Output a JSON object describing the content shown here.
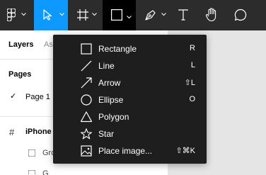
{
  "toolbar": {
    "tools": [
      {
        "name": "main-menu",
        "icon": "figma-logo-icon"
      },
      {
        "name": "move-tool",
        "icon": "cursor-arrow-icon",
        "active": true
      },
      {
        "name": "frame-tool",
        "icon": "frame-hash-icon"
      },
      {
        "name": "shape-tool",
        "icon": "rectangle-icon",
        "active": true
      },
      {
        "name": "pen-tool",
        "icon": "pen-icon"
      },
      {
        "name": "text-tool",
        "icon": "text-icon"
      },
      {
        "name": "hand-tool",
        "icon": "hand-icon"
      },
      {
        "name": "comment-tool",
        "icon": "comment-icon"
      }
    ],
    "colors": {
      "background": "#2c2c2c",
      "active_blue": "#0d99ff",
      "active_black": "#000000"
    }
  },
  "panel": {
    "tabs": {
      "layers": "Layers",
      "assets": "As"
    },
    "pages_label": "Pages",
    "page": {
      "check": "✓",
      "name": "Page 1"
    },
    "frame": {
      "icon": "#",
      "name": "iPhone"
    },
    "layers": [
      "Gro",
      "G"
    ]
  },
  "menu": {
    "items": [
      {
        "label": "Rectangle",
        "shortcut": "R",
        "icon": "rectangle-icon"
      },
      {
        "label": "Line",
        "shortcut": "L",
        "icon": "line-icon"
      },
      {
        "label": "Arrow",
        "shortcut": "⇧L",
        "icon": "arrow-icon"
      },
      {
        "label": "Ellipse",
        "shortcut": "O",
        "icon": "ellipse-icon"
      },
      {
        "label": "Polygon",
        "shortcut": "",
        "icon": "polygon-icon"
      },
      {
        "label": "Star",
        "shortcut": "",
        "icon": "star-icon"
      },
      {
        "label": "Place image...",
        "shortcut": "⇧⌘K",
        "icon": "image-icon"
      }
    ],
    "colors": {
      "background": "#1e1e1e",
      "text": "#ffffff"
    }
  }
}
